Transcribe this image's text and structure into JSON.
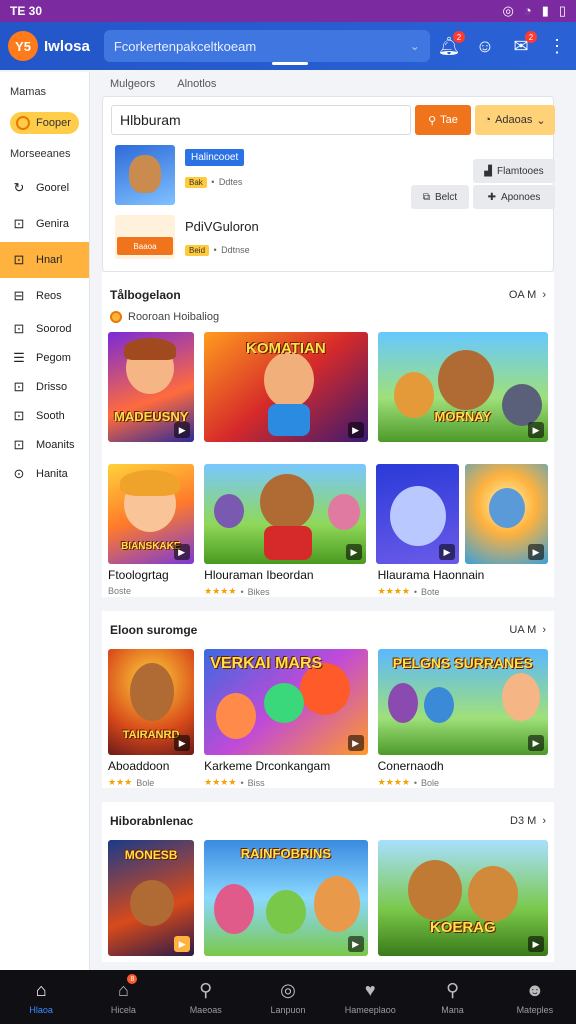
{
  "status": {
    "time": "TE 30",
    "icons": [
      "bell-badge-icon",
      "wifi-icon",
      "signal-icon",
      "battery-icon"
    ]
  },
  "appbar": {
    "logo_text": "Iwlosa",
    "logo_badge": "Y5",
    "search_value": "Fcorkertenpakceltkoeam",
    "notif_badge": "2",
    "msg_badge": "2"
  },
  "sidebar": {
    "header": "Mamas",
    "pill_label": "Fooper",
    "sub_header": "Morseeanes",
    "items": [
      {
        "icon": "↻",
        "label": "Goorel"
      },
      {
        "icon": "⊡",
        "label": "Genira"
      },
      {
        "icon": "⊡",
        "label": "Hnarl"
      },
      {
        "icon": "⊟",
        "label": "Reos"
      },
      {
        "icon": "⊡",
        "label": "Soorod"
      },
      {
        "icon": "☰",
        "label": "Pegom"
      },
      {
        "icon": "⊡",
        "label": "Drisso"
      },
      {
        "icon": "⊡",
        "label": "Sooth"
      },
      {
        "icon": "⊡",
        "label": "Moanits"
      },
      {
        "icon": "⊙",
        "label": "Hanita"
      }
    ]
  },
  "main": {
    "crumbs": [
      "Mulgeors",
      "Alnotlos"
    ],
    "search": {
      "value": "Hlbburam",
      "btn1": "Tae",
      "btn2": "Adaoas"
    },
    "item1": {
      "tag": "Halincooet",
      "mini": "Bak",
      "meta": "Ddtes"
    },
    "item2": {
      "name": "PdiVGuloron",
      "mini": "Beid",
      "meta": "Ddtnse",
      "thumb_btn": "Baaoa"
    },
    "buttons": {
      "top_right": "Flamtooes",
      "mid": "Belct",
      "right": "Aponoes"
    },
    "sections": [
      {
        "title": "Tålbogelaon",
        "right": "OA M",
        "sub": "Rooroan  Hoibaliog",
        "cards": [
          {
            "label": "MADEUSNY",
            "cta": "▶"
          },
          {
            "label": "KOMATIAN",
            "cta": "▶"
          },
          {
            "label": "MORNAY",
            "cta": "▶"
          },
          {
            "label": "BIANSKAKE",
            "cta": "▶"
          },
          {
            "label": "",
            "cta": "▶"
          },
          {
            "label": "",
            "cta": "▶"
          },
          {
            "label": "",
            "cta": "▶"
          }
        ],
        "titles": [
          {
            "name": "Ftoologrtag",
            "stars": "★★★★",
            "count": "Boste"
          },
          {
            "name": "Hlouraman Ibeordan",
            "stars": "★★★★",
            "count": "Bikes"
          },
          {
            "name": "Hlaurama Haonnain",
            "stars": "★★★★",
            "count": "Bote"
          }
        ]
      },
      {
        "title": "Eloon suromge",
        "right": "UA M",
        "cards": [
          {
            "label": "TAIRANRD",
            "cta": "▶"
          },
          {
            "label": "VERKAI  MARS",
            "cta": "▶"
          },
          {
            "label": "PELGNS SURRANES",
            "cta": "▶"
          }
        ],
        "titles": [
          {
            "name": "Aboaddoon",
            "stars": "★★★",
            "count": "Bole"
          },
          {
            "name": "Karkeme Drconkangam",
            "stars": "★★★★",
            "count": "Biss"
          },
          {
            "name": "Conernaodh",
            "stars": "★★★★",
            "count": "Bole"
          }
        ]
      },
      {
        "title": "Hiborabnlenac",
        "right": "D3 M",
        "cards": [
          {
            "label": "MONESB",
            "cta": "▶"
          },
          {
            "label": "RAINFOBRINS",
            "cta": "▶"
          },
          {
            "label": "KOERAG",
            "cta": "▶"
          }
        ]
      }
    ]
  },
  "bottomnav": [
    {
      "icon": "⌂",
      "label": "Hlaoa",
      "badge": ""
    },
    {
      "icon": "⌂",
      "label": "Hicela",
      "badge": "8"
    },
    {
      "icon": "⚲",
      "label": "Maeoas",
      "badge": ""
    },
    {
      "icon": "◎",
      "label": "Lanpuon",
      "badge": ""
    },
    {
      "icon": "♥",
      "label": "Hameeplaoo",
      "badge": ""
    },
    {
      "icon": "⚲",
      "label": "Mana",
      "badge": ""
    },
    {
      "icon": "☻",
      "label": "Mateples",
      "badge": ""
    }
  ],
  "colors": {
    "primary": "#2356c8",
    "accent": "#f0741c",
    "yellow": "#ffcd4a",
    "statusbar": "#7b2aa0"
  }
}
